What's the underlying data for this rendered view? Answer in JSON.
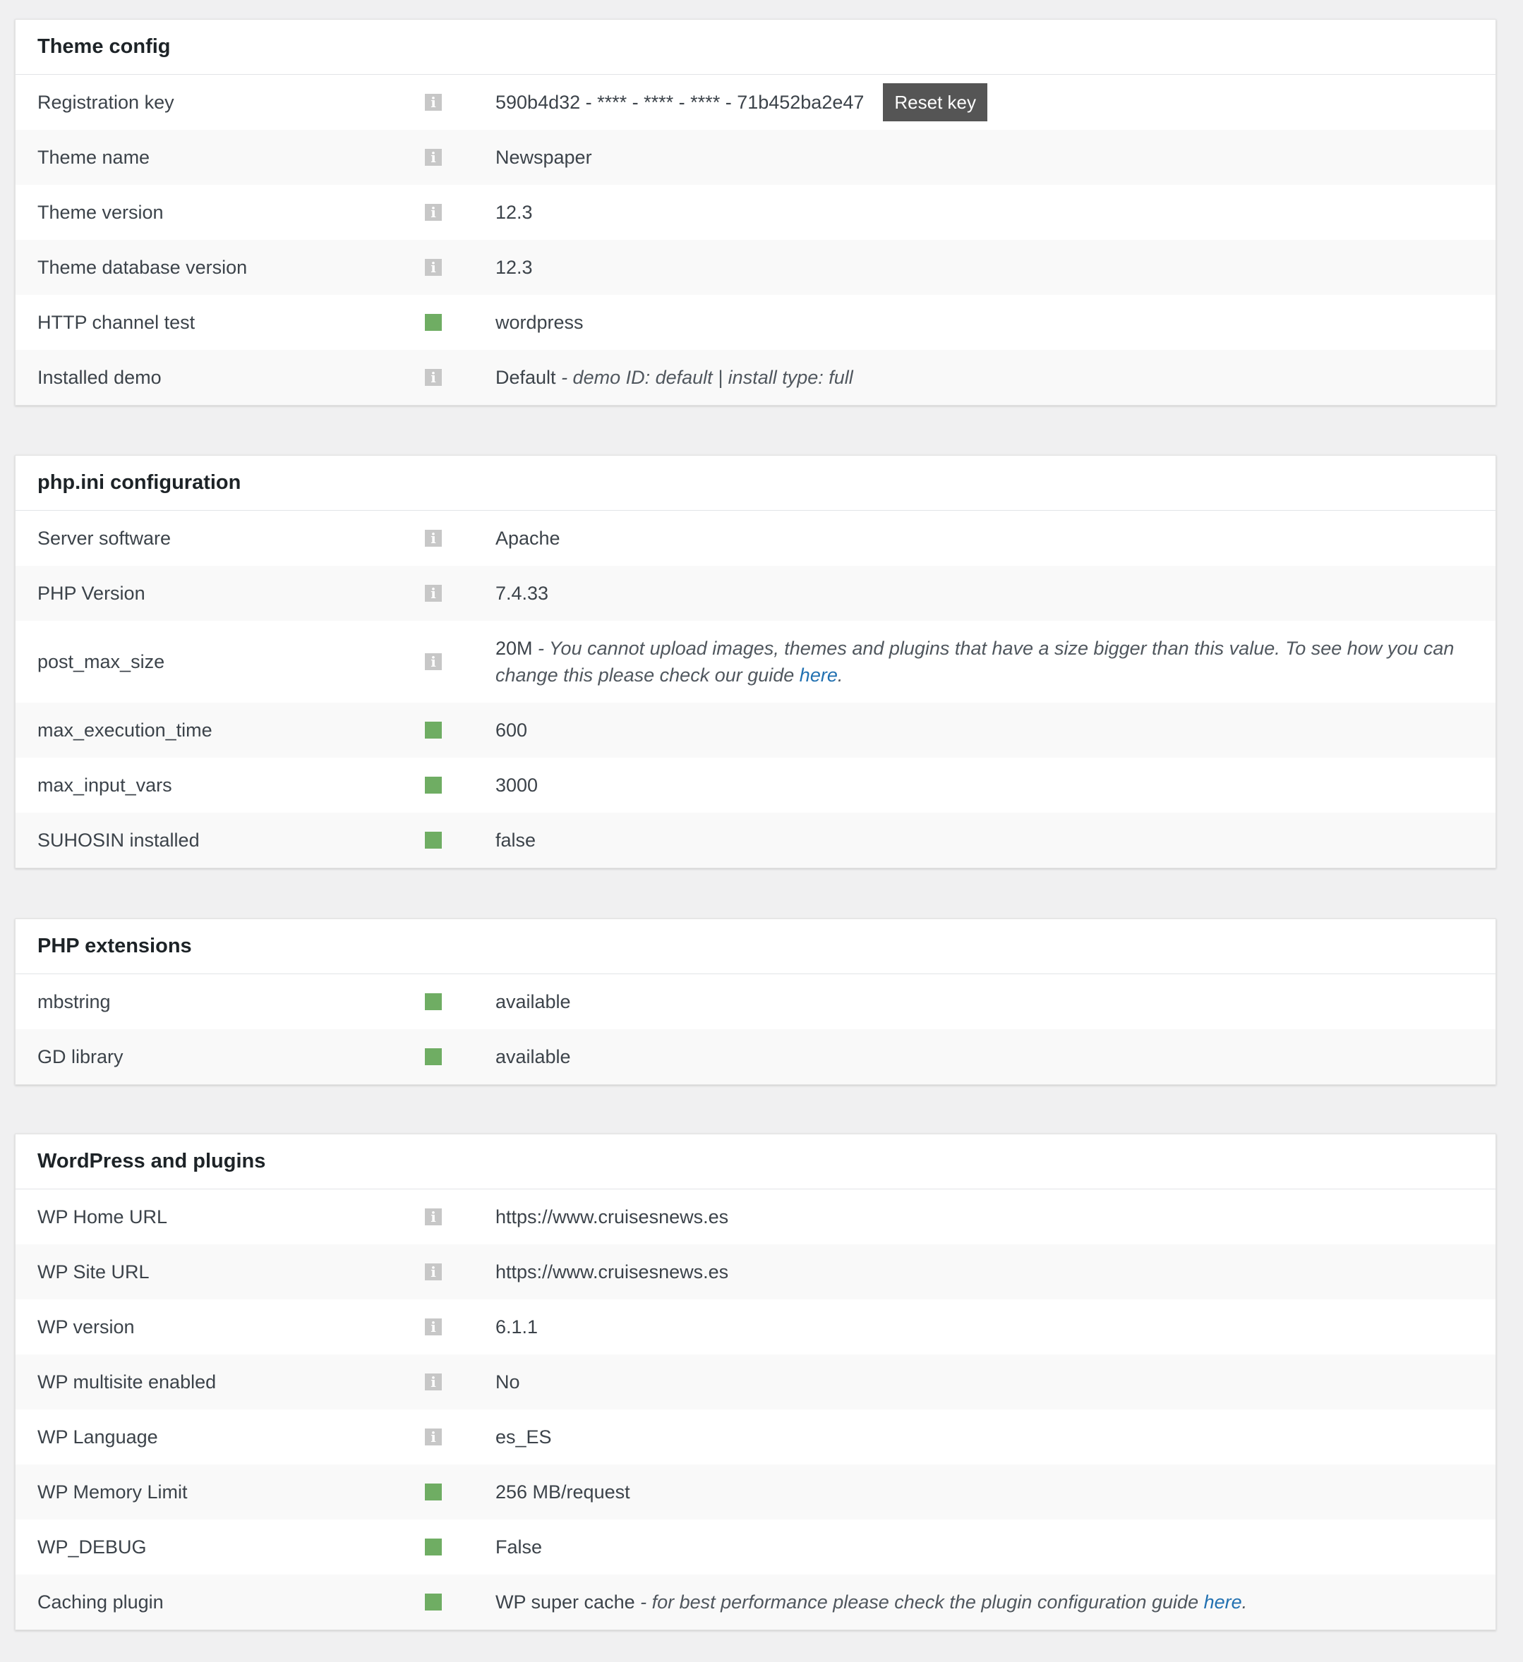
{
  "sections": [
    {
      "title": "Theme config",
      "rows": [
        {
          "label": "Registration key",
          "status": "info",
          "value": "590b4d32 - **** - **** - **** - 71b452ba2e47",
          "button": "Reset key"
        },
        {
          "label": "Theme name",
          "status": "info",
          "value": "Newspaper"
        },
        {
          "label": "Theme version",
          "status": "info",
          "value": "12.3"
        },
        {
          "label": "Theme database version",
          "status": "info",
          "value": "12.3"
        },
        {
          "label": "HTTP channel test",
          "status": "ok",
          "value": "wordpress"
        },
        {
          "label": "Installed demo",
          "status": "info",
          "value": "Default",
          "note": " - demo ID: default | install type: full"
        }
      ]
    },
    {
      "title": "php.ini configuration",
      "rows": [
        {
          "label": "Server software",
          "status": "info",
          "value": "Apache"
        },
        {
          "label": "PHP Version",
          "status": "info",
          "value": "7.4.33"
        },
        {
          "label": "post_max_size",
          "status": "info",
          "value": "20M",
          "note": " - You cannot upload images, themes and plugins that have a size bigger than this value. To see how you can change this please check our guide ",
          "link": "here",
          "after": "."
        },
        {
          "label": "max_execution_time",
          "status": "ok",
          "value": "600"
        },
        {
          "label": "max_input_vars",
          "status": "ok",
          "value": "3000"
        },
        {
          "label": "SUHOSIN installed",
          "status": "ok",
          "value": "false"
        }
      ]
    },
    {
      "title": "PHP extensions",
      "rows": [
        {
          "label": "mbstring",
          "status": "ok",
          "value": "available"
        },
        {
          "label": "GD library",
          "status": "ok",
          "value": "available"
        }
      ]
    },
    {
      "title": "WordPress and plugins",
      "rows": [
        {
          "label": "WP Home URL",
          "status": "info",
          "value": "https://www.cruisesnews.es"
        },
        {
          "label": "WP Site URL",
          "status": "info",
          "value": "https://www.cruisesnews.es"
        },
        {
          "label": "WP version",
          "status": "info",
          "value": "6.1.1"
        },
        {
          "label": "WP multisite enabled",
          "status": "info",
          "value": "No"
        },
        {
          "label": "WP Language",
          "status": "info",
          "value": "es_ES"
        },
        {
          "label": "WP Memory Limit",
          "status": "ok",
          "value": "256 MB/request"
        },
        {
          "label": "WP_DEBUG",
          "status": "ok",
          "value": "False"
        },
        {
          "label": "Caching plugin",
          "status": "ok",
          "value": "WP super cache",
          "note": " - for best performance please check the plugin configuration guide ",
          "link": "here",
          "after": "."
        }
      ]
    }
  ],
  "status_icons": {
    "info": "info-icon",
    "ok": "status-ok-icon"
  },
  "info_glyph": "i",
  "colors": {
    "ok": "#6fad63",
    "info": "#c7c7c7",
    "link": "#2271b1",
    "button": "#555555"
  }
}
